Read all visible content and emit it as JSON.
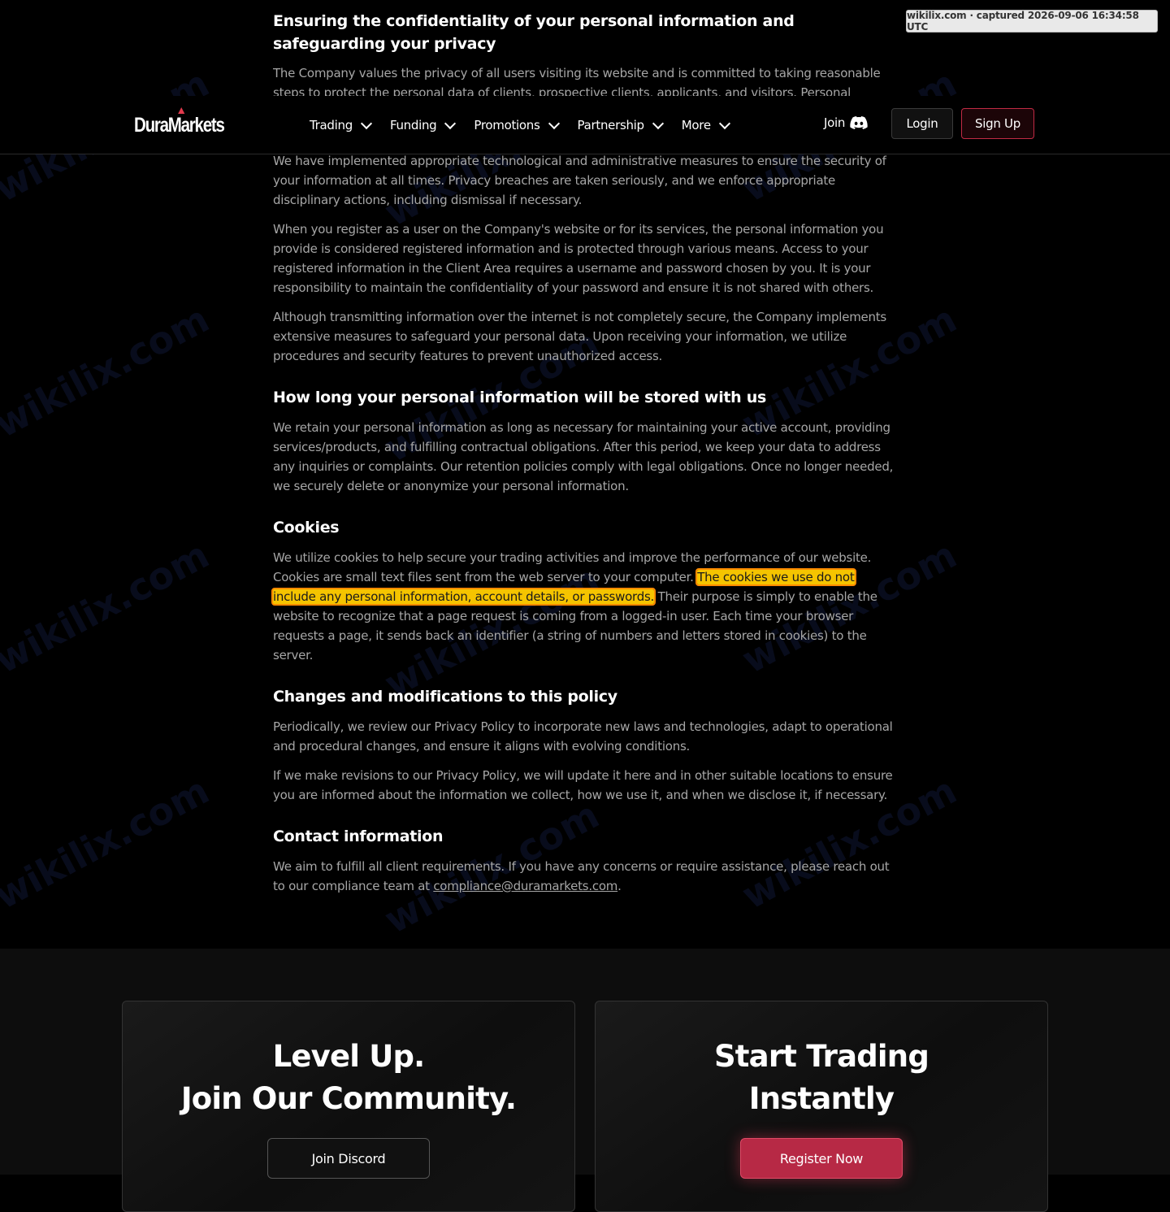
{
  "capture_badge": "wikilix.com · captured 2026-09-06 16:34:58 UTC",
  "watermark": "wikilix.com",
  "header": {
    "logo": "DuraMarkets",
    "nav": [
      {
        "label": "Trading"
      },
      {
        "label": "Funding"
      },
      {
        "label": "Promotions"
      },
      {
        "label": "Partnership"
      },
      {
        "label": "More"
      }
    ],
    "join_label": "Join",
    "login_label": "Login",
    "signup_label": "Sign Up"
  },
  "content": {
    "s1_title": "Ensuring the confidentiality of your personal information and safeguarding your privacy",
    "s1_p1": "The Company values the privacy of all users visiting its website and is committed to taking reasonable steps to protect the personal data of clients, prospective clients, applicants, and visitors. Personal",
    "s1_p2": "We have implemented appropriate technological and administrative measures to ensure the security of your information at all times. Privacy breaches are taken seriously, and we enforce appropriate disciplinary actions, including dismissal if necessary.",
    "s1_p3": "When you register as a user on the Company's website or for its services, the personal information you provide is considered registered information and is protected through various means. Access to your registered information in the Client Area requires a username and password chosen by you. It is your responsibility to maintain the confidentiality of your password and ensure it is not shared with others.",
    "s1_p4": "Although transmitting information over the internet is not completely secure, the Company implements extensive measures to safeguard your personal data. Upon receiving your information, we utilize procedures and security features to prevent unauthorized access.",
    "s2_title": "How long your personal information will be stored with us",
    "s2_p1": "We retain your personal information as long as necessary for maintaining your active account, providing services/products, and fulfilling contractual obligations. After this period, we keep your data to address any inquiries or complaints. Our retention policies comply with legal obligations. Once no longer needed, we securely delete or anonymize your personal information.",
    "s3_title": "Cookies",
    "s3_p1_a": "We utilize cookies to help secure your trading activities and improve the performance of our website. Cookies are small text files sent from the web server to your computer.",
    "s3_p1_hl": "The cookies we use do not include any personal information, account details, or passwords.",
    "s3_p1_b": "Their purpose is simply to enable the website to recognize that a page request is coming from a logged-in user. Each time your browser requests a page, it sends back an identifier (a string of numbers and letters stored in cookies) to the server.",
    "s4_title": "Changes and modifications to this policy",
    "s4_p1": "Periodically, we review our Privacy Policy to incorporate new laws and technologies, adapt to operational and procedural changes, and ensure it aligns with evolving conditions.",
    "s4_p2": "If we make revisions to our Privacy Policy, we will update it here and in other suitable locations to ensure you are informed about the information we collect, how we use it, and when we disclose it, if necessary.",
    "s5_title": "Contact information",
    "s5_p1_a": "We aim to fulfill all client requirements. If you have any concerns or require assistance, please reach out to our compliance team at ",
    "s5_email": "compliance@duramarkets.com",
    "s5_p1_b": "."
  },
  "footer": {
    "card1_line1": "Level Up.",
    "card1_line2": "Join Our Community.",
    "card1_button": "Join Discord",
    "card2_line1": "Start Trading",
    "card2_line2": "Instantly",
    "card2_button": "Register Now"
  },
  "colors": {
    "accent": "#b72945",
    "highlight": "#f5c400",
    "background": "#000000"
  }
}
